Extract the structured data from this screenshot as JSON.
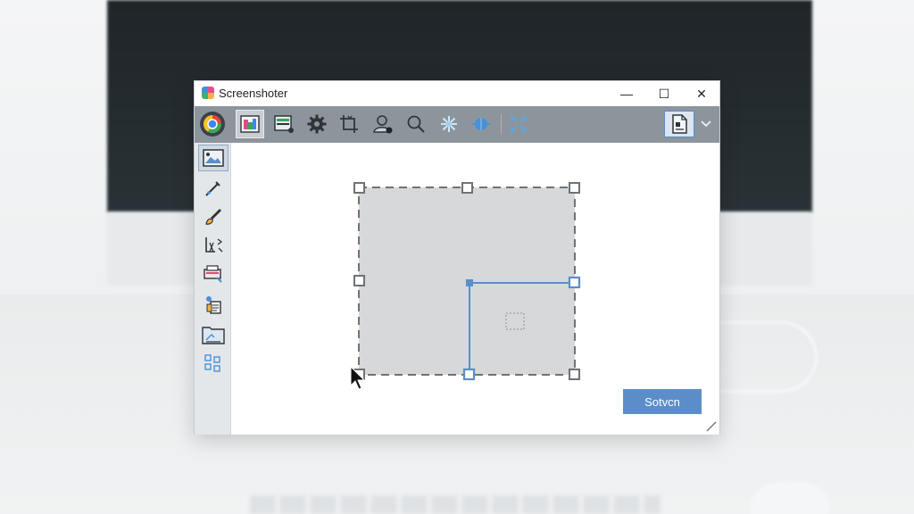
{
  "window": {
    "title": "Screenshoter",
    "controls": {
      "minimize": "—",
      "maximize": "☐",
      "close": "✕"
    }
  },
  "toolbar": {
    "items": [
      {
        "name": "browser-icon"
      },
      {
        "name": "image-capture-icon",
        "selected": true
      },
      {
        "name": "stack-icon"
      },
      {
        "name": "gear-icon"
      },
      {
        "name": "crop-icon"
      },
      {
        "name": "user-icon"
      },
      {
        "name": "search-icon"
      },
      {
        "name": "sparkle-icon"
      },
      {
        "name": "globe-icon"
      },
      {
        "name": "expand-icon"
      }
    ],
    "right": [
      {
        "name": "document-icon"
      },
      {
        "name": "chevron-down-icon"
      }
    ]
  },
  "sidebar": {
    "items": [
      {
        "name": "image-tool-icon",
        "active": true
      },
      {
        "name": "pen-tool-icon"
      },
      {
        "name": "brush-tool-icon"
      },
      {
        "name": "transform-tool-icon"
      },
      {
        "name": "print-tool-icon"
      },
      {
        "name": "clipboard-tool-icon"
      },
      {
        "name": "folder-tool-icon"
      },
      {
        "name": "grid-tool-icon"
      }
    ]
  },
  "actions": {
    "submit_label": "Sotvcn"
  },
  "colors": {
    "toolbar_bg": "#8d959c",
    "accent": "#5b8ec9",
    "selection_fill": "#d6d8da",
    "selection_border": "#6f7377",
    "guide_line": "#5b8ec9"
  }
}
